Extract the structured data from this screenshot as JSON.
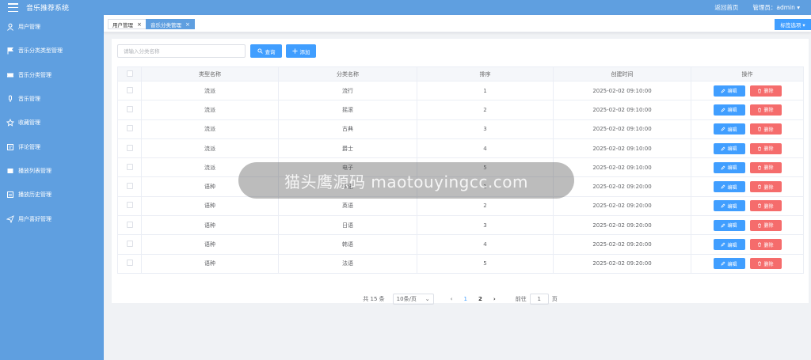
{
  "header": {
    "title": "音乐推荐系统",
    "home_link": "返回首页",
    "user_label": "管理员：admin ▾"
  },
  "sidebar": {
    "items": [
      {
        "label": "用户管理",
        "icon": "user-icon"
      },
      {
        "label": "音乐分类类型管理",
        "icon": "flag-icon"
      },
      {
        "label": "音乐分类管理",
        "icon": "ticket-icon"
      },
      {
        "label": "音乐管理",
        "icon": "microphone-icon"
      },
      {
        "label": "收藏管理",
        "icon": "star-icon"
      },
      {
        "label": "评论管理",
        "icon": "comment-icon"
      },
      {
        "label": "播放列表管理",
        "icon": "playlist-icon"
      },
      {
        "label": "播放历史管理",
        "icon": "history-icon"
      },
      {
        "label": "用户喜好管理",
        "icon": "send-icon"
      }
    ]
  },
  "tabs": [
    {
      "label": "用户管理",
      "close": "×"
    },
    {
      "label": "音乐分类管理",
      "close": "×"
    }
  ],
  "tab_options": "标签选项 ▾",
  "toolbar": {
    "search_placeholder": "请输入分类名称",
    "query_label": "查询",
    "add_label": "添加"
  },
  "table": {
    "columns": [
      "类型名称",
      "分类名称",
      "排序",
      "创建时间",
      "操作"
    ],
    "edit_label": "编辑",
    "delete_label": "删除",
    "rows": [
      {
        "type": "流派",
        "name": "流行",
        "sort": "1",
        "created": "2025-02-02 09:10:00"
      },
      {
        "type": "流派",
        "name": "摇滚",
        "sort": "2",
        "created": "2025-02-02 09:10:00"
      },
      {
        "type": "流派",
        "name": "古典",
        "sort": "3",
        "created": "2025-02-02 09:10:00"
      },
      {
        "type": "流派",
        "name": "爵士",
        "sort": "4",
        "created": "2025-02-02 09:10:00"
      },
      {
        "type": "流派",
        "name": "电子",
        "sort": "5",
        "created": "2025-02-02 09:10:00"
      },
      {
        "type": "语种",
        "name": "华语",
        "sort": "1",
        "created": "2025-02-02 09:20:00"
      },
      {
        "type": "语种",
        "name": "英语",
        "sort": "2",
        "created": "2025-02-02 09:20:00"
      },
      {
        "type": "语种",
        "name": "日语",
        "sort": "3",
        "created": "2025-02-02 09:20:00"
      },
      {
        "type": "语种",
        "name": "韩语",
        "sort": "4",
        "created": "2025-02-02 09:20:00"
      },
      {
        "type": "语种",
        "name": "法语",
        "sort": "5",
        "created": "2025-02-02 09:20:00"
      }
    ]
  },
  "pagination": {
    "total": "共 15 条",
    "page_size": "10条/页",
    "prev": "‹",
    "pages": [
      "1",
      "2"
    ],
    "next": "›",
    "goto_label": "前往",
    "goto_value": "1",
    "page_suffix": "页"
  },
  "watermark": "猫头鹰源码 maotouyingcc.com",
  "colors": {
    "brand": "#5f9fe0",
    "primary": "#409eff",
    "danger": "#f56c6c"
  }
}
